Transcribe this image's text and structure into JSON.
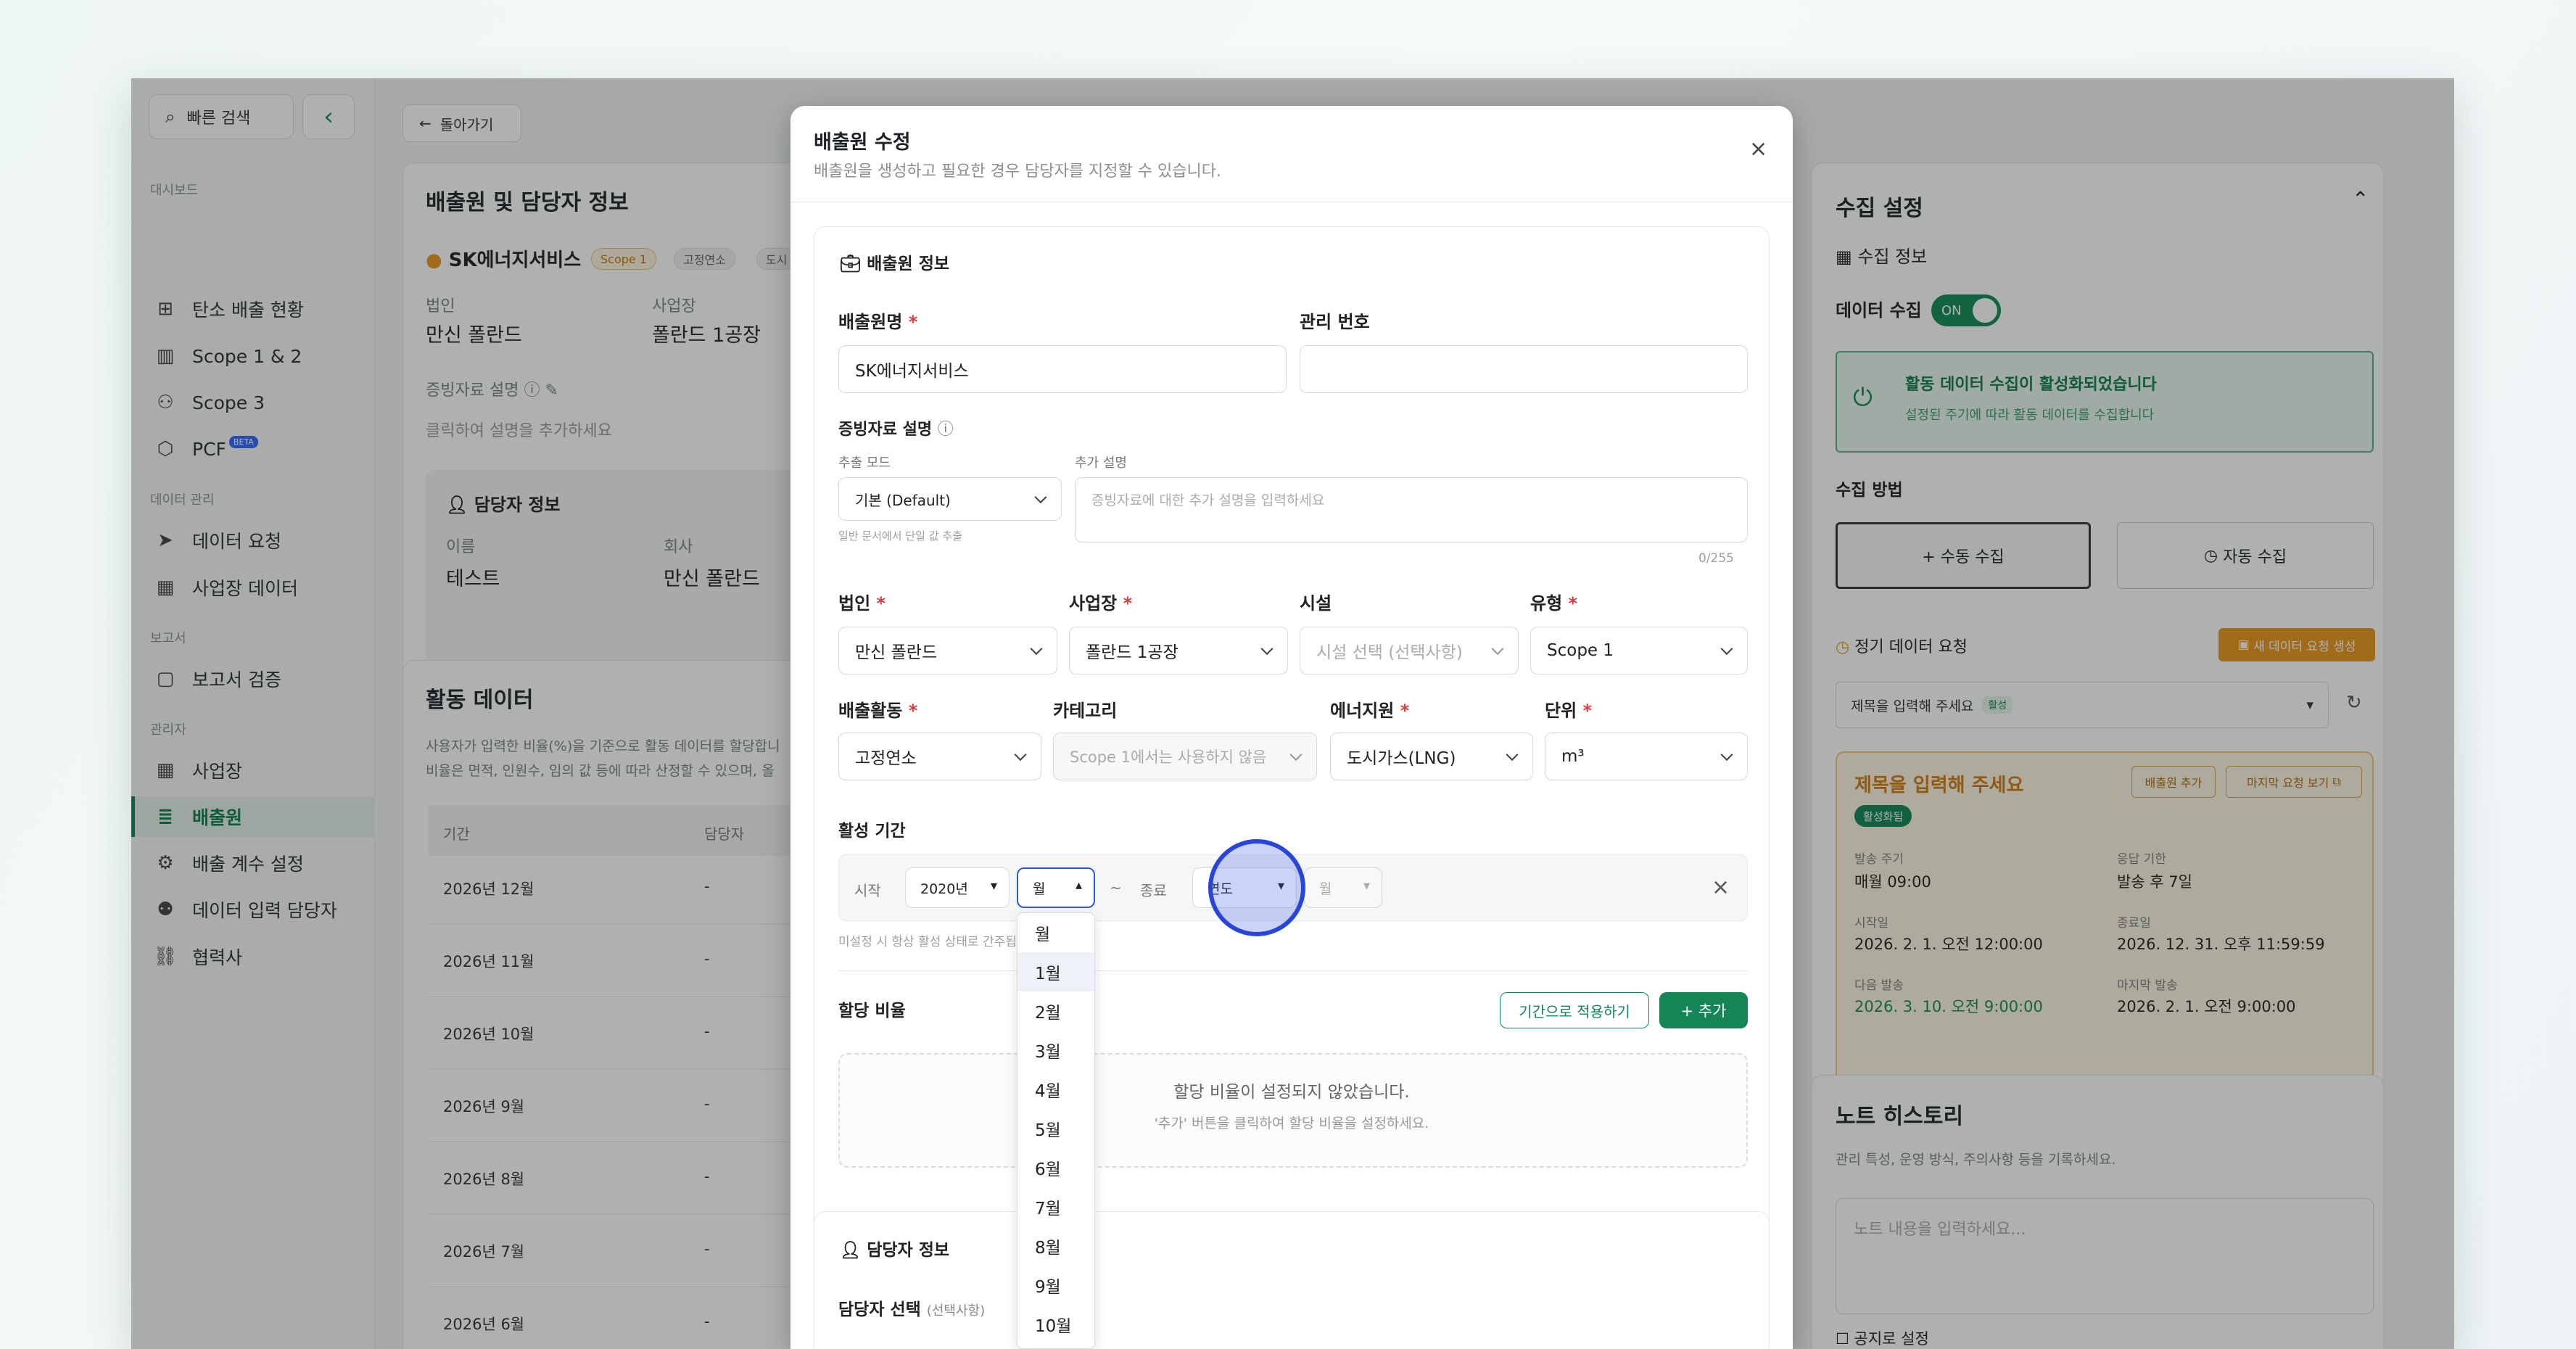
{
  "sidebar": {
    "search_label": "빠른 검색",
    "sections": [
      "대시보드",
      "데이터 관리",
      "보고서",
      "관리자"
    ],
    "items": [
      {
        "label": "탄소 배출 현황"
      },
      {
        "label": "Scope 1 & 2"
      },
      {
        "label": "Scope 3"
      },
      {
        "label": "PCF",
        "badge": "BETA"
      },
      {
        "label": "데이터 요청"
      },
      {
        "label": "사업장 데이터"
      },
      {
        "label": "보고서 검증"
      },
      {
        "label": "사업장"
      },
      {
        "label": "배출원"
      },
      {
        "label": "배출 계수 설정"
      },
      {
        "label": "데이터 입력 담당자"
      },
      {
        "label": "협력사"
      }
    ]
  },
  "main": {
    "back_label": "돌아가기",
    "source_info": {
      "title": "배출원 및 담당자 정보",
      "company": "SK에너지서비스",
      "tags": [
        "Scope 1",
        "고정연소",
        "도시"
      ],
      "corp_label": "법인",
      "corp_value": "만신 폴란드",
      "site_label": "사업장",
      "site_value": "폴란드 1공장",
      "evidence_label": "증빙자료 설명",
      "evidence_hint": "클릭하여 설명을 추가하세요",
      "manager_title": "담당자 정보",
      "name_label": "이름",
      "name_value": "테스트",
      "company_label": "회사",
      "company_value": "만신 폴란드"
    },
    "activity": {
      "title": "활동 데이터",
      "desc1": "사용자가 입력한 비율(%)을 기준으로 활동 데이터를 할당합니",
      "desc2": "비율은 면적, 인원수, 임의 값 등에 따라 산정할 수 있으며, 올",
      "col_period": "기간",
      "col_manager": "담당자",
      "rows": [
        {
          "period": "2026년 12월",
          "manager": "-"
        },
        {
          "period": "2026년 11월",
          "manager": "-"
        },
        {
          "period": "2026년 10월",
          "manager": "-"
        },
        {
          "period": "2026년 9월",
          "manager": "-"
        },
        {
          "period": "2026년 8월",
          "manager": "-"
        },
        {
          "period": "2026년 7월",
          "manager": "-"
        },
        {
          "period": "2026년 6월",
          "manager": "-"
        }
      ]
    }
  },
  "right": {
    "collect": {
      "title": "수집 설정",
      "info_title": "수집 정보",
      "data_collect_label": "데이터 수집",
      "toggle_label": "ON",
      "active_title": "활동 데이터 수집이 활성화되었습니다",
      "active_desc": "설정된 주기에 따라 활동 데이터를 수집합니다",
      "method_label": "수집 방법",
      "manual_label": "+ 수동 수집",
      "auto_label": "자동 수집",
      "periodic_label": "정기 데이터 요청",
      "new_request_label": "새 데이터 요청 생성",
      "title_select": "제목을 입력해 주세요",
      "title_select_badge": "활성",
      "req_card": {
        "title": "제목을 입력해 주세요",
        "status": "활성화됨",
        "add_source": "배출원 추가",
        "view_last": "마지막 요청 보기",
        "send_cycle_label": "발송 주기",
        "send_cycle_value": "매월 09:00",
        "deadline_label": "응답 기한",
        "deadline_value": "발송 후 7일",
        "start_label": "시작일",
        "start_value": "2026. 2. 1. 오전 12:00:00",
        "end_label": "종료일",
        "end_value": "2026. 12. 31. 오후 11:59:59",
        "next_label": "다음 발송",
        "next_value": "2026. 3. 10. 오전 9:00:00",
        "last_label": "마지막 발송",
        "last_value": "2026. 2. 1. 오전 9:00:00"
      }
    },
    "notes": {
      "title": "노트 히스토리",
      "desc": "관리 특성, 운영 방식, 주의사항 등을 기록하세요.",
      "placeholder": "노트 내용을 입력하세요...",
      "notice_label": "공지로 설정"
    }
  },
  "modal": {
    "title": "배출원 수정",
    "subtitle": "배출원을 생성하고 필요한 경우 담당자를 지정할 수 있습니다.",
    "close": "×",
    "section_title": "배출원 정보",
    "source_name_label": "배출원명",
    "source_name_value": "SK에너지서비스",
    "mgmt_no_label": "관리 번호",
    "mgmt_no_value": "",
    "evidence_label": "증빙자료 설명",
    "extract_mode_label": "추출 모드",
    "extract_mode_value": "기본 (Default)",
    "extract_mode_hint": "일반 문서에서 단일 값 추출",
    "extra_desc_label": "추가 설명",
    "extra_desc_placeholder": "증빙자료에 대한 추가 설명을 입력하세요",
    "char_count": "0/255",
    "corp_label": "법인",
    "corp_value": "만신 폴란드",
    "site_label": "사업장",
    "site_value": "폴란드 1공장",
    "facility_label": "시설",
    "facility_placeholder": "시설 선택 (선택사항)",
    "type_label": "유형",
    "type_value": "Scope 1",
    "activity_label": "배출활동",
    "activity_value": "고정연소",
    "category_label": "카테고리",
    "category_placeholder": "Scope 1에서는 사용하지 않음",
    "energy_label": "에너지원",
    "energy_value": "도시가스(LNG)",
    "unit_label": "단위",
    "unit_value": "m³",
    "period_label": "활성 기간",
    "start_label": "시작",
    "start_year": "2020년",
    "start_month": "월",
    "tilde": "~",
    "end_label": "종료",
    "end_year": "연도",
    "end_month": "월",
    "period_hint": "미설정 시 항상 활성 상태로 간주됩",
    "alloc_label": "할당 비율",
    "apply_period_label": "기간으로 적용하기",
    "add_label": "+ 추가",
    "alloc_empty": "할당 비율이 설정되지 않았습니다.",
    "alloc_empty_hint": "'추가' 버튼을 클릭하여 할당 비율을 설정하세요.",
    "manager_section": "담당자 정보",
    "manager_select_label": "담당자 선택",
    "manager_select_optional": "(선택사항)",
    "month_options": [
      "월",
      "1월",
      "2월",
      "3월",
      "4월",
      "5월",
      "6월",
      "7월",
      "8월",
      "9월",
      "10월"
    ]
  },
  "colors": {
    "brand": "#138556",
    "orange": "#e8961e",
    "click_ring": "#2846d8"
  }
}
